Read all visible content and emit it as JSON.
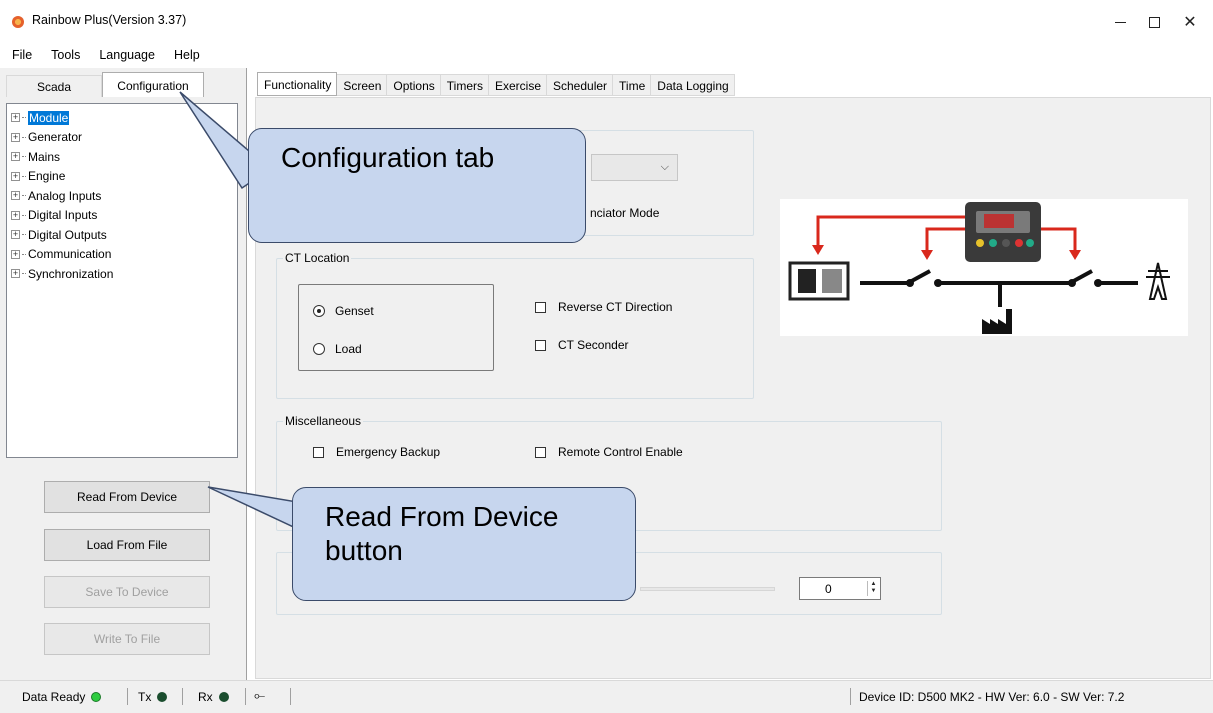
{
  "window": {
    "title": "Rainbow Plus(Version 3.37)",
    "minimize": "",
    "maximize": "",
    "close": "✕"
  },
  "menu": [
    "File",
    "Tools",
    "Language",
    "Help"
  ],
  "left_tabs": {
    "scada": "Scada",
    "configuration": "Configuration"
  },
  "tree": [
    "Module",
    "Generator",
    "Mains",
    "Engine",
    "Analog Inputs",
    "Digital Inputs",
    "Digital Outputs",
    "Communication",
    "Synchronization"
  ],
  "buttons": {
    "read": "Read From Device",
    "load": "Load From File",
    "save": "Save To Device",
    "write": "Write To File"
  },
  "right_tabs": [
    "Functionality",
    "Screen",
    "Options",
    "Timers",
    "Exercise",
    "Scheduler",
    "Time",
    "Data Logging"
  ],
  "functionality": {
    "annunciator_partial": "nciator Mode",
    "ct_location": {
      "title": "CT Location",
      "genset": "Genset",
      "load": "Load",
      "selected": "Genset",
      "reverse": "Reverse CT Direction",
      "seconder": "CT Seconder"
    },
    "misc": {
      "title": "Miscellaneous",
      "emergency": "Emergency Backup",
      "remote": "Remote Control Enable"
    },
    "spin_value": "0"
  },
  "callouts": {
    "config": "Configuration tab",
    "read": "Read From Device button"
  },
  "status": {
    "data_ready": "Data Ready",
    "tx": "Tx",
    "rx": "Rx",
    "usb": "⟜",
    "device": "Device ID: D500 MK2 - HW Ver: 6.0 - SW Ver: 7.2",
    "colors": {
      "data_ready_led": "#2ecc40",
      "tx_led": "#1a4d2e",
      "rx_led": "#1a4d2e"
    }
  }
}
